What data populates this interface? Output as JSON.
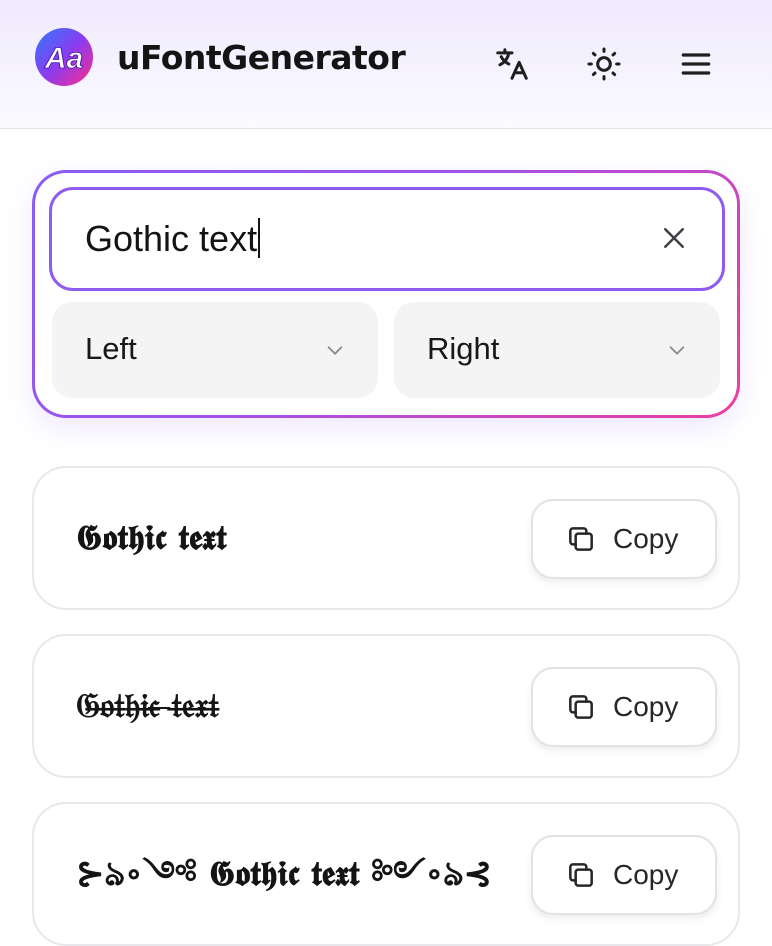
{
  "header": {
    "logo_text": "Aa",
    "brand": "uFontGenerator",
    "translate_icon": "translate-icon",
    "theme_icon": "sun-icon",
    "menu_icon": "hamburger-menu-icon"
  },
  "search": {
    "value": "Gothic text",
    "clear_icon": "close-icon",
    "left_select": {
      "value": "Left",
      "icon": "chevron-down-icon"
    },
    "right_select": {
      "value": "Right",
      "icon": "chevron-down-icon"
    }
  },
  "results": [
    {
      "text": "𝕲𝖔𝖙𝖍𝖎𝖈 𝖙𝖊𝖝𝖙",
      "copy_label": "Copy",
      "copy_icon": "copy-icon"
    },
    {
      "text": "𝔊̶𝔬̶𝔱̶𝔥̶𝔦̶𝔠̶ ̶𝔱̶𝔢̶𝔵̶𝔱̶",
      "copy_label": "Copy",
      "copy_icon": "copy-icon"
    },
    {
      "text": "⊱ঌ∘༺ 𝕲𝖔𝖙𝖍𝖎𝖈 𝖙𝖊𝖝𝖙 ༻∘ঌ⊰",
      "copy_label": "Copy",
      "copy_icon": "copy-icon"
    }
  ],
  "colors": {
    "accent_start": "#8a5cf6",
    "accent_end": "#e93fa0",
    "input_border": "#8f5cf0",
    "select_bg": "#f4f4f5"
  }
}
